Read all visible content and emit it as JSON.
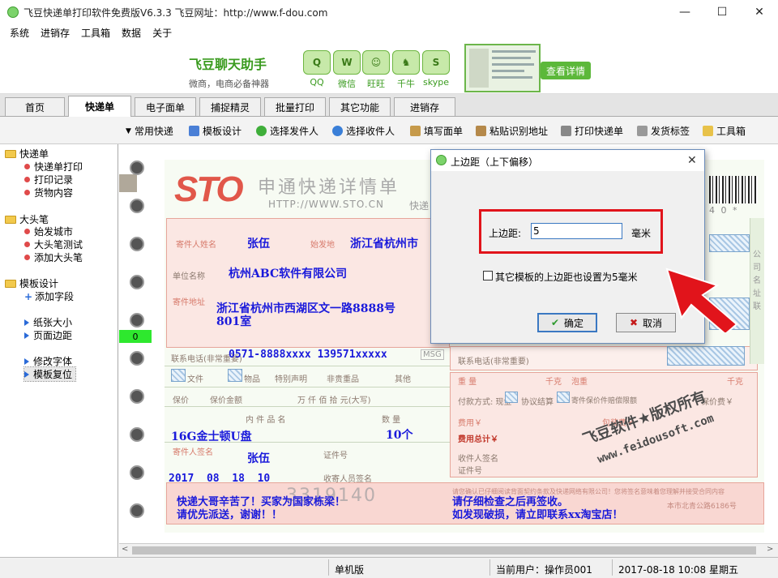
{
  "window": {
    "title": "飞豆快递单打印软件免费版V6.3.3   飞豆网址：http://www.f-dou.com",
    "minimize": "—",
    "maximize": "☐",
    "close": "✕"
  },
  "menu": [
    "系统",
    "进销存",
    "工具箱",
    "数据",
    "关于"
  ],
  "ad": {
    "title": "飞豆聊天助手",
    "subtitle": "微商，电商必备神器",
    "icons": [
      {
        "glyph": "Q",
        "label": "QQ"
      },
      {
        "glyph": "W",
        "label": "微信"
      },
      {
        "glyph": "☺",
        "label": "旺旺"
      },
      {
        "glyph": "♞",
        "label": "千牛"
      },
      {
        "glyph": "S",
        "label": "skype"
      }
    ],
    "button": "查看详情"
  },
  "tabs": [
    "首页",
    "快递单",
    "电子面单",
    "捕捉精灵",
    "批量打印",
    "其它功能",
    "进销存"
  ],
  "active_tab": "快递单",
  "toolbar": [
    "常用快递",
    "模板设计",
    "选择发件人",
    "选择收件人",
    "填写面单",
    "粘贴识别地址",
    "打印快递单",
    "发货标签",
    "工具箱"
  ],
  "sidebar": {
    "groups": [
      {
        "label": "快递单",
        "items": [
          {
            "label": "快递单打印",
            "mark": "dot"
          },
          {
            "label": "打印记录",
            "mark": "dot"
          },
          {
            "label": "货物内容",
            "mark": "dot"
          }
        ]
      },
      {
        "label": "大头笔",
        "items": [
          {
            "label": "始发城市",
            "mark": "dot"
          },
          {
            "label": "大头笔测试",
            "mark": "dot"
          },
          {
            "label": "添加大头笔",
            "mark": "dot"
          }
        ]
      },
      {
        "label": "模板设计",
        "items": [
          {
            "label": "添加字段",
            "mark": "plus"
          },
          {
            "label": "纸张大小",
            "mark": "tri"
          },
          {
            "label": "页面边距",
            "mark": "tri"
          },
          {
            "label": "修改字体",
            "mark": "tri"
          },
          {
            "label": "模板复位",
            "mark": "tri"
          }
        ]
      }
    ]
  },
  "ruler_marker": "0",
  "waybill": {
    "brand": "STO",
    "heading": "申通快递详情单",
    "url": "HTTP://WWW.STO.CN",
    "express_label": "快递",
    "barcode_suffix": "4 0 *",
    "tracking_number": "3319140",
    "labels": {
      "sender_name": "寄件人姓名",
      "origin": "始发地",
      "company": "单位名称",
      "address": "寄件地址",
      "phone": "联系电话(非常重要)",
      "doc": "文件",
      "goods": "物品",
      "special": "特别声明",
      "fragile": "非贵重品",
      "other": "其他",
      "insure": "保价",
      "insure_amount": "保价金额",
      "amount_units": "万  仟  佰  拾  元(大写)",
      "contents": "内 件 品 名",
      "qty": "数 量",
      "sender_sign": "寄件人签名",
      "cert": "证件号",
      "receiver_sign": "收件人签名",
      "cert2": "证件号",
      "collector": "收寄人员签名",
      "weight": "重 量",
      "kg1": "千克",
      "net_weight": "泡重",
      "kg2": "千克",
      "payment": "付款方式: 现金",
      "settle": "协议结算",
      "insure_fee": "寄件保价件赔偿限额",
      "cash": "现金",
      "account": "月结",
      "insure_rate": "保价费￥",
      "fee": "费用￥",
      "pack_fee": "包装费￥",
      "total": "费用总计￥",
      "receiver_phone": "联系电话(非常重要)",
      "address_hint": "本市北青公路6186号",
      "side": "公司名址联"
    },
    "sender_name": "张伍",
    "origin": "浙江省杭州市",
    "company": "杭州ABC软件有限公司",
    "address_line1": "浙江省杭州市西湖区文一路8888号",
    "address_line2": "801室",
    "phone": "0571-8888xxxx 139571xxxxx",
    "msg": "MSG",
    "item": "16G金士顿U盘",
    "quantity": "10个",
    "signer": "张伍",
    "date": "2017  08  18  10",
    "note1_line1": "快递大哥辛苦了！买家为国家栋梁！",
    "note1_line2": "请优先派送，谢谢！！",
    "note2_line1": "请仔细检查之后再签收。",
    "note2_line2": "如发现破损，请立即联系xx淘宝店！",
    "watermark_line1": "飞豆软件★版权所有",
    "watermark_line2": "www.feidousoft.com",
    "fine_print": "请您确认已仔细阅读背面契约条款及快递网络有限公司！您将签名意味着您理解并接受合同内容"
  },
  "dialog": {
    "title": "上边距（上下偏移）",
    "field_label": "上边距:",
    "field_value": "5",
    "unit": "毫米",
    "checkbox_label": "其它模板的上边距也设置为5毫米",
    "ok": "确定",
    "cancel": "取消"
  },
  "status": {
    "mode": "单机版",
    "user": "当前用户：操作员001",
    "datetime": "2017-08-18 10:08 星期五"
  },
  "colors": {
    "accent_green": "#5cb83a",
    "highlight_red": "#e1141b",
    "fill_blue": "#1a1adb",
    "sto_red": "#d9392b"
  }
}
